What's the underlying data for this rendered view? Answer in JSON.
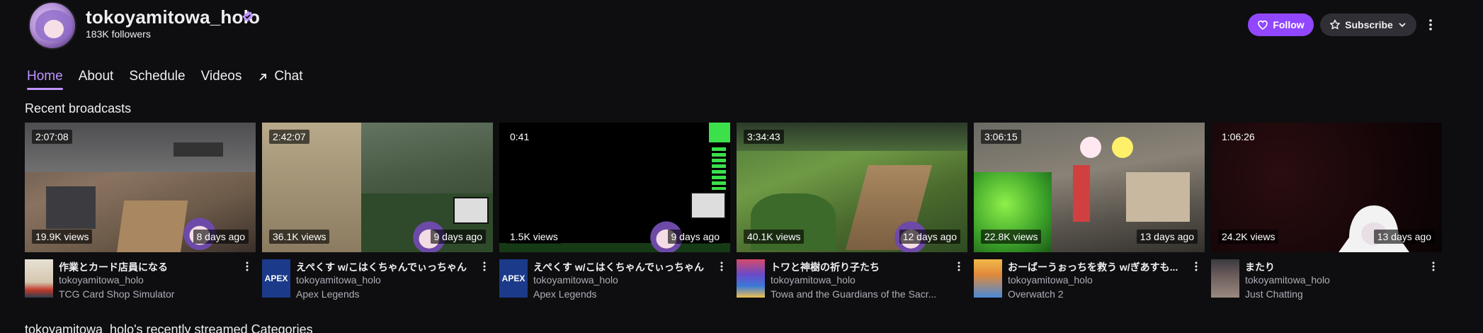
{
  "channel": {
    "name": "tokoyamitowa_holo",
    "followers": "183K followers",
    "follow_label": "Follow",
    "subscribe_label": "Subscribe"
  },
  "nav": {
    "tabs": [
      {
        "label": "Home",
        "active": true
      },
      {
        "label": "About"
      },
      {
        "label": "Schedule"
      },
      {
        "label": "Videos"
      },
      {
        "label": "Chat"
      }
    ]
  },
  "recent": {
    "title": "Recent broadcasts",
    "videos": [
      {
        "duration": "2:07:08",
        "views": "19.9K views",
        "ago": "8 days ago",
        "title": "作業とカード店員になる",
        "channel": "tokoyamitowa_holo",
        "category": "TCG Card Shop Simulator"
      },
      {
        "duration": "2:42:07",
        "views": "36.1K views",
        "ago": "9 days ago",
        "title": "えぺくす w/こはくちゃんでぃっちゃん",
        "channel": "tokoyamitowa_holo",
        "category": "Apex Legends"
      },
      {
        "duration": "0:41",
        "views": "1.5K views",
        "ago": "9 days ago",
        "title": "えぺくす w/こはくちゃんでぃっちゃん",
        "channel": "tokoyamitowa_holo",
        "category": "Apex Legends"
      },
      {
        "duration": "3:34:43",
        "views": "40.1K views",
        "ago": "12 days ago",
        "title": "トワと神樹の祈り子たち",
        "channel": "tokoyamitowa_holo",
        "category": "Towa and the Guardians of the Sacr..."
      },
      {
        "duration": "3:06:15",
        "views": "22.8K views",
        "ago": "13 days ago",
        "title": "おーばーうぉっちを救う w/ぎあすも...",
        "channel": "tokoyamitowa_holo",
        "category": "Overwatch 2"
      },
      {
        "duration": "1:06:26",
        "views": "24.2K views",
        "ago": "13 days ago",
        "title": "またり",
        "channel": "tokoyamitowa_holo",
        "category": "Just Chatting"
      }
    ]
  },
  "categories_section": {
    "title": "tokoyamitowa_holo's recently streamed Categories"
  },
  "colors": {
    "accent": "#9147ff",
    "accent_light": "#bf94ff",
    "background": "#0e0e10",
    "muted_text": "#adadb8"
  }
}
